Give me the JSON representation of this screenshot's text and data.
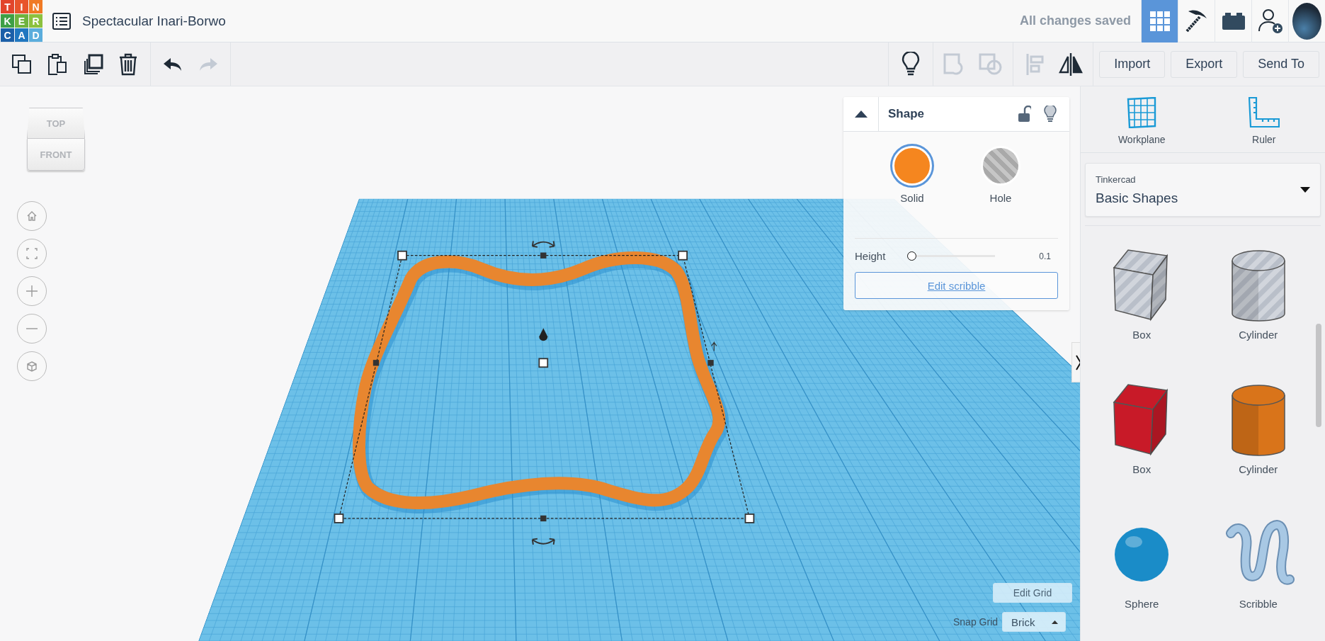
{
  "topbar": {
    "logo": [
      {
        "letter": "T",
        "color": "#e2452b"
      },
      {
        "letter": "I",
        "color": "#e8542b"
      },
      {
        "letter": "N",
        "color": "#f07a24"
      },
      {
        "letter": "K",
        "color": "#3e9f45"
      },
      {
        "letter": "E",
        "color": "#6fb33f"
      },
      {
        "letter": "R",
        "color": "#8cc13f"
      },
      {
        "letter": "C",
        "color": "#1b5fa8"
      },
      {
        "letter": "A",
        "color": "#2077c0"
      },
      {
        "letter": "D",
        "color": "#5aaddc"
      }
    ],
    "title": "Spectacular Inari-Borwo",
    "save_status": "All changes saved",
    "nav": [
      {
        "kind": "grid",
        "selected": true
      },
      {
        "kind": "pickaxe",
        "selected": false
      },
      {
        "kind": "brick",
        "selected": false
      },
      {
        "kind": "user-add",
        "selected": false
      },
      {
        "kind": "avatar",
        "selected": false
      }
    ]
  },
  "toolbar": {
    "left": [
      {
        "kind": "copy",
        "disabled": false
      },
      {
        "kind": "paste",
        "disabled": false
      },
      {
        "kind": "duplicate",
        "disabled": false
      },
      {
        "kind": "delete",
        "disabled": false
      },
      {
        "kind": "undo",
        "disabled": false
      },
      {
        "kind": "redo",
        "disabled": true
      }
    ],
    "right": [
      {
        "kind": "bulb",
        "disabled": false
      },
      {
        "kind": "group",
        "disabled": true
      },
      {
        "kind": "ungroup",
        "disabled": true
      },
      {
        "kind": "align",
        "disabled": true
      },
      {
        "kind": "mirror",
        "disabled": false
      }
    ],
    "buttons": [
      "Import",
      "Export",
      "Send To"
    ]
  },
  "viewcube": {
    "top": "TOP",
    "front": "FRONT"
  },
  "view_controls": [
    {
      "kind": "home"
    },
    {
      "kind": "fit"
    },
    {
      "kind": "zoom-in"
    },
    {
      "kind": "zoom-out"
    },
    {
      "kind": "ortho"
    }
  ],
  "shape_panel": {
    "title": "Shape",
    "expanded": true,
    "locked": false,
    "types": [
      {
        "label": "Solid",
        "kind": "solid",
        "selected": true
      },
      {
        "label": "Hole",
        "kind": "hole",
        "selected": false
      }
    ],
    "height": {
      "label": "Height",
      "level": 0.0,
      "value": "0.1"
    },
    "edit_button": "Edit scribble"
  },
  "grid_controls": {
    "edit_button": "Edit Grid",
    "snap_label": "Snap Grid",
    "snap_value": "Brick"
  },
  "sidebar": {
    "tools": [
      {
        "kind": "workplane",
        "label": "Workplane"
      },
      {
        "kind": "ruler",
        "label": "Ruler"
      }
    ],
    "library": {
      "source": "Tinkercad",
      "category": "Basic Shapes"
    },
    "shapes": [
      {
        "kind": "box",
        "label": "Box",
        "hole": true,
        "color": "#b9bfc9"
      },
      {
        "kind": "cylinder",
        "label": "Cylinder",
        "hole": true,
        "color": "#b9bfc9"
      },
      {
        "kind": "box",
        "label": "Box",
        "hole": false,
        "color": "#c81a28"
      },
      {
        "kind": "cylinder",
        "label": "Cylinder",
        "hole": false,
        "color": "#d9741a"
      },
      {
        "kind": "sphere",
        "label": "Sphere",
        "hole": false,
        "color": "#1a8cc8"
      },
      {
        "kind": "scribble",
        "label": "Scribble",
        "hole": false,
        "color": "#a8c8e4"
      }
    ]
  }
}
